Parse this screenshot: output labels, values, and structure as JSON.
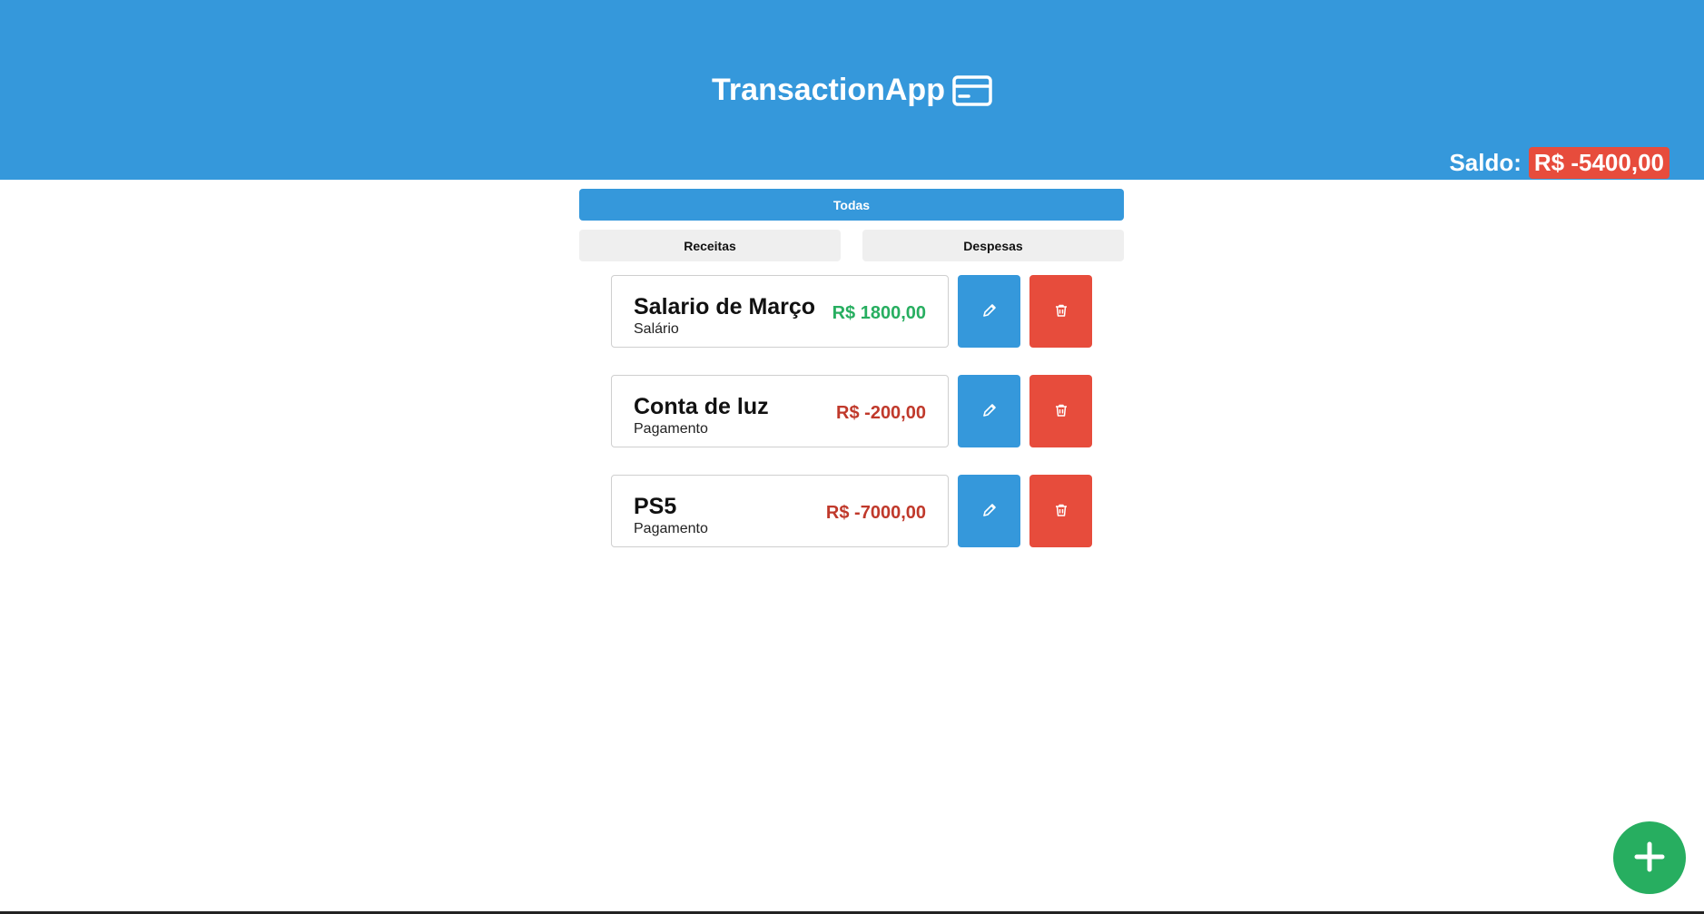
{
  "header": {
    "app_name": "TransactionApp",
    "app_icon": "credit-card-icon",
    "balance_label": "Saldo:",
    "balance_value": "R$ -5400,00",
    "background_color": "#3598db",
    "balance_badge_color": "#e74c3c"
  },
  "filters": {
    "all_label": "Todas",
    "income_label": "Receitas",
    "expense_label": "Despesas",
    "active": "Todas"
  },
  "transactions": [
    {
      "title": "Salario de Março",
      "category": "Salário",
      "amount": "R$ 1800,00",
      "type": "income",
      "amount_color": "#27ae60"
    },
    {
      "title": "Conta de luz",
      "category": "Pagamento",
      "amount": "R$ -200,00",
      "type": "expense",
      "amount_color": "#c0392b"
    },
    {
      "title": "PS5",
      "category": "Pagamento",
      "amount": "R$ -7000,00",
      "type": "expense",
      "amount_color": "#c0392b"
    }
  ],
  "actions": {
    "edit_icon": "pencil-icon",
    "delete_icon": "trash-icon",
    "add_icon": "plus-icon",
    "edit_color": "#3598db",
    "delete_color": "#e74c3c",
    "add_color": "#27ae60"
  }
}
